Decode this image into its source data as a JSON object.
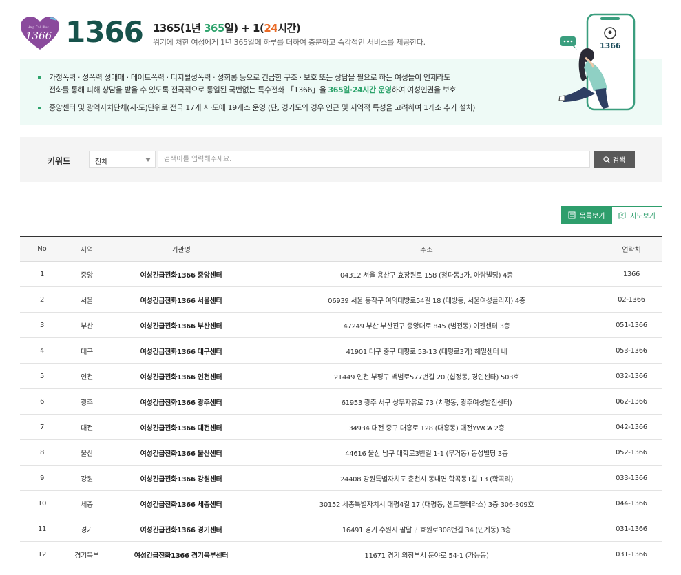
{
  "header": {
    "logo_small_text": "Help Call Plus",
    "logo_number": "1366",
    "number": "1366",
    "headline_a": "1365(1년 ",
    "headline_b": "365",
    "headline_c": "일) + 1(",
    "headline_d": "24",
    "headline_e": "시간)",
    "subline": "위기에 처한 여성에게 1년 365일에 하루를 더하여 충분하고 즉각적인 서비스를 제공한다.",
    "phone_number": "1366"
  },
  "info": {
    "line1": "가정폭력 · 성폭력 성매매 · 데이트폭력 · 디지털성폭력 · 성희롱 등으로 긴급한 구조 · 보호 또는 상담을 필요로 하는 여성들이 언제라도",
    "line2a": "전화를 통해 피해 상담을 받을 수 있도록 전국적으로 통일된 국번없는 특수전화 「1366」을 ",
    "line2b": "365일·24시간 운영",
    "line2c": "하여 여성인권을 보호",
    "line3": "중앙센터 및 광역자치단체(시·도)단위로 전국 17개 시·도에 19개소 운영 (단, 경기도의 경우 인근 및 지역적 특성을 고려하여 1개소 추가 설치)"
  },
  "search": {
    "label": "키워드",
    "select_value": "전체",
    "placeholder": "검색어를 입력해주세요.",
    "value": "",
    "button": "검색"
  },
  "view": {
    "list_label": "목록보기",
    "map_label": "지도보기"
  },
  "table": {
    "headers": [
      "No",
      "지역",
      "기관명",
      "주소",
      "연락처"
    ],
    "rows": [
      [
        "1",
        "중앙",
        "여성긴급전화1366 중앙센터",
        "04312  서울 용산구 효창원로 158 (청파동3가, 아람빌딩)  4층",
        "1366"
      ],
      [
        "2",
        "서울",
        "여성긴급전화1366 서울센터",
        "06939  서울 동작구 여의대방로54길 18 (대방동, 서울여성플라자)  4층",
        "02-1366"
      ],
      [
        "3",
        "부산",
        "여성긴급전화1366 부산센터",
        "47249  부산 부산진구 중앙대로 845 (범전동)  이젠센터 3층",
        "051-1366"
      ],
      [
        "4",
        "대구",
        "여성긴급전화1366 대구센터",
        "41901  대구 중구 태평로 53-13 (태평로3가)  해밀센터 내",
        "053-1366"
      ],
      [
        "5",
        "인천",
        "여성긴급전화1366 인천센터",
        "21449  인천 부평구 백범로577번길 20 (십정동, 경인센타)  503호",
        "032-1366"
      ],
      [
        "6",
        "광주",
        "여성긴급전화1366 광주센터",
        "61953  광주 서구 상무자유로 73 (치평동, 광주여성발전센터)",
        "062-1366"
      ],
      [
        "7",
        "대전",
        "여성긴급전화1366 대전센터",
        "34934  대전 중구 대흥로 128 (대흥동)  대전YWCA 2층",
        "042-1366"
      ],
      [
        "8",
        "울산",
        "여성긴급전화1366 울산센터",
        "44616  울산 남구 대학로3번길 1-1 (무거동)  동성빌딩 3층",
        "052-1366"
      ],
      [
        "9",
        "강원",
        "여성긴급전화1366 강원센터",
        "24408  강원특별자치도 춘천시 동내면 학곡동1길 13 (학곡리)",
        "033-1366"
      ],
      [
        "10",
        "세종",
        "여성긴급전화1366 세종센터",
        "30152  세종특별자치시 대평4길 17 (대평동, 센트럴테라스)  3층 306-309호",
        "044-1366"
      ],
      [
        "11",
        "경기",
        "여성긴급전화1366 경기센터",
        "16491  경기 수원시 팔달구 효원로308번길 34 (인계동)  3층",
        "031-1366"
      ],
      [
        "12",
        "경기북부",
        "여성긴급전화1366 경기북부센터",
        "11671  경기 의정부시 둔야로 54-1 (가능동)",
        "031-1366"
      ]
    ]
  },
  "colors": {
    "brand_dark": "#17524b",
    "accent_green": "#2ea36c",
    "accent_orange": "#ea6b27",
    "logo_purple": "#8a4a9c"
  }
}
